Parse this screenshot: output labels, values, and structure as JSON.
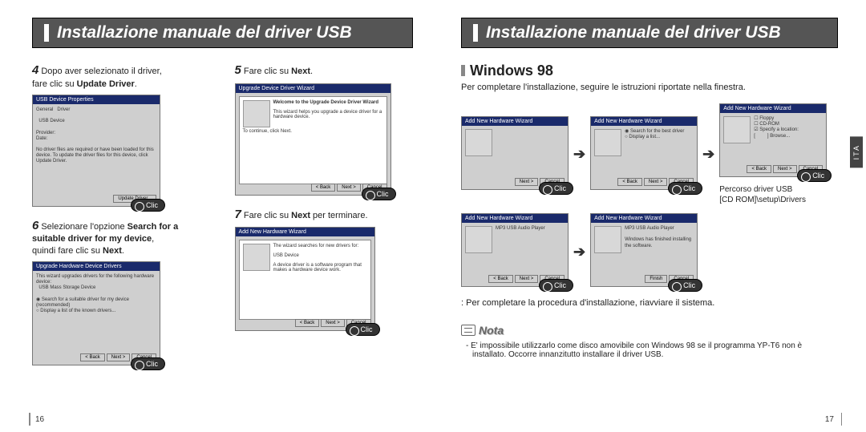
{
  "headerLeft": "Installazione manuale del driver USB",
  "headerRight": "Installazione manuale del driver USB",
  "tabLabel": "ITA",
  "left": {
    "step4_num": "4",
    "step4_a": "Dopo aver selezionato il driver,",
    "step4_b": "fare clic su ",
    "step4_bold": "Update Driver",
    "step4_end": ".",
    "step5_num": "5",
    "step5_a": "Fare clic su ",
    "step5_bold": "Next",
    "step5_end": ".",
    "step6_num": "6",
    "step6_a": "Selezionare l'opzione ",
    "step6_bold1": "Search for a",
    "step6_bold2": "suitable driver for my device",
    "step6_c": ",",
    "step6_d": "quindi fare clic su ",
    "step6_bold3": "Next",
    "step6_end": ".",
    "step7_num": "7",
    "step7_a": "Fare clic su ",
    "step7_bold": "Next",
    "step7_b": " per terminare.",
    "click": "Clic",
    "pageNum": "16",
    "shot": {
      "title1": "USB Device Properties",
      "title2": "Upgrade Device Driver Wizard",
      "title3": "Upgrade Hardware Device Drivers",
      "title4": "Add New Hardware Wizard",
      "wizHead": "Welcome to the Upgrade Device Driver Wizard",
      "wizBody": "This wizard helps you upgrade a device driver for a hardware device.",
      "wizCont": "To continue, click Next.",
      "btnBack": "< Back",
      "btnNext": "Next >",
      "btnCancel": "Cancel"
    }
  },
  "right": {
    "sectionTitle": "Windows 98",
    "intro": "Per completare l'installazione, seguire le istruzioni riportate nella finestra.",
    "click": "Clic",
    "pathLabel": "Percorso driver USB",
    "pathValue": "[CD ROM]\\setup\\Drivers",
    "completion": ": Per completare la procedura d'installazione, riavviare il sistema.",
    "noteLabel": "Nota",
    "noteText": "- E' impossibile utilizzarlo come disco amovibile con Windows 98 se il programma YP-T6 non è installato. Occorre innanzitutto installare il driver USB.",
    "pageNum": "17",
    "shotTitle": "Add New Hardware Wizard"
  },
  "chart_data": null
}
